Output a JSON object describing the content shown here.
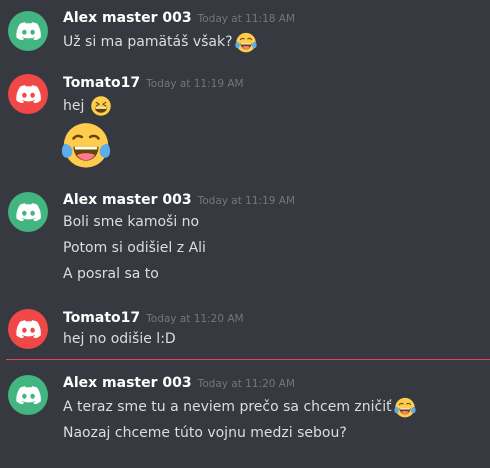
{
  "colors": {
    "discord_green": "#43b581",
    "discord_red": "#f04747",
    "background": "#36393f",
    "new_divider": "#d94b52"
  },
  "messages": [
    {
      "user": "Alex master 003",
      "time": "Today at 11:18 AM",
      "avatar_icon": "discord-logo-icon",
      "avatar_color": "green",
      "lines": [
        "Už si ma pamätáš však?"
      ]
    },
    {
      "user": "Tomato17",
      "time": "Today at 11:19 AM",
      "avatar_icon": "discord-logo-icon",
      "avatar_color": "red",
      "lines": [
        "hej"
      ]
    },
    {
      "user": "Alex master 003",
      "time": "Today at 11:19 AM",
      "avatar_icon": "discord-logo-icon",
      "avatar_color": "green",
      "lines": [
        "Boli sme kamoši no",
        "Potom si odišiel z Ali",
        "A posral sa to"
      ]
    },
    {
      "user": "Tomato17",
      "time": "Today at 11:20 AM",
      "avatar_icon": "discord-logo-icon",
      "avatar_color": "red",
      "lines": [
        "hej no odišie l:D"
      ]
    },
    {
      "user": "Alex master 003",
      "time": "Today at 11:20 AM",
      "avatar_icon": "discord-logo-icon",
      "avatar_color": "green",
      "lines": [
        "A teraz sme tu a neviem prečo sa chcem zničiť",
        "Naozaj chceme túto vojnu medzi sebou?"
      ]
    }
  ],
  "emojis": [
    "tears-of-joy-emoji-icon",
    "grinning-squinting-emoji-icon",
    "tears-of-joy-emoji-icon",
    "tears-of-joy-emoji-icon"
  ]
}
